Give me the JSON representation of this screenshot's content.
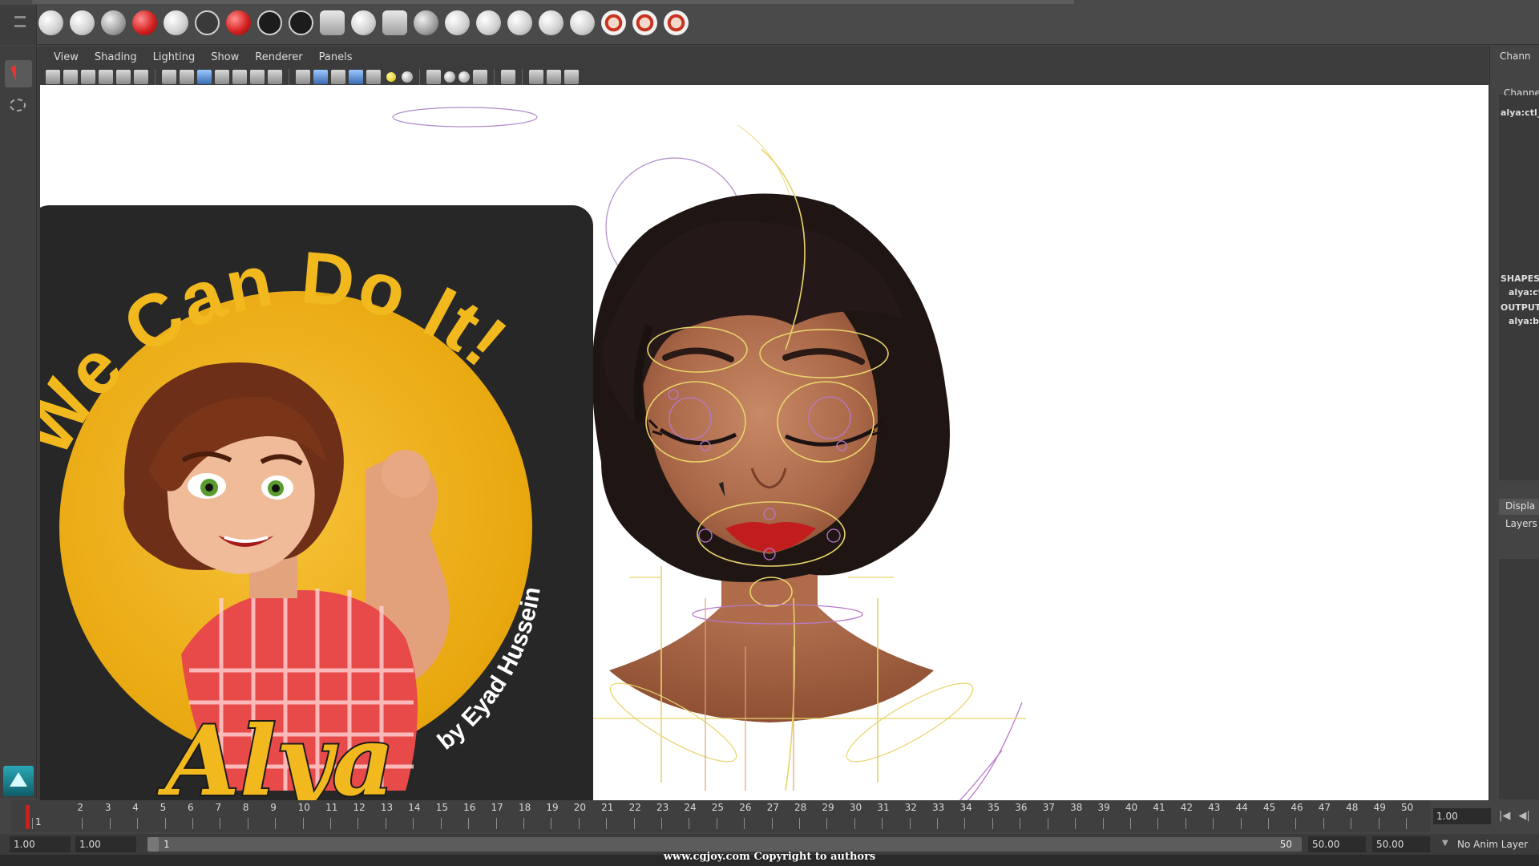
{
  "app": {
    "name": "Maya"
  },
  "panel_menu": [
    "View",
    "Shading",
    "Lighting",
    "Show",
    "Renderer",
    "Panels"
  ],
  "channel_box": {
    "title": "Chann",
    "header": "Channe",
    "object": "alya:ctl_",
    "shapes_label": "SHAPES",
    "shapes_item": "alya:ct",
    "outputs_label": "OUTPUT",
    "outputs_item": "alya:bl",
    "tab_display": "Displa",
    "tab_layers": "Layers"
  },
  "poster": {
    "title": "We Can Do It!",
    "name": "Alya",
    "byline": "by Eyad Hussein"
  },
  "timeline": {
    "ticks": [
      "1",
      "2",
      "3",
      "4",
      "5",
      "6",
      "7",
      "8",
      "9",
      "10",
      "11",
      "12",
      "13",
      "14",
      "15",
      "16",
      "17",
      "18",
      "19",
      "20",
      "21",
      "22",
      "23",
      "24",
      "25",
      "26",
      "27",
      "28",
      "29",
      "30",
      "31",
      "32",
      "33",
      "34",
      "35",
      "36",
      "37",
      "38",
      "39",
      "40",
      "41",
      "42",
      "43",
      "44",
      "45",
      "46",
      "47",
      "48",
      "49",
      "50"
    ],
    "current_frame_label": "1",
    "current_time": "1.00",
    "controls": [
      "|◀",
      "◀|"
    ]
  },
  "range": {
    "anim_start": "1.00",
    "playback_start": "1.00",
    "range_start": "1",
    "range_end": "50",
    "playback_end": "50.00",
    "anim_end": "50.00",
    "anim_layer": "No Anim Layer"
  },
  "footer": {
    "copyright": "www.cgjoy.com Copyright to authors"
  },
  "colors": {
    "viewport_bg": "#ffffff",
    "ui_bg": "#444444",
    "poster_yellow": "#f2b91f",
    "poster_dark": "#272727",
    "skin": "#b87453",
    "hair": "#1e1614",
    "lips": "#c21d1d",
    "rig_yellow": "#e8d46b",
    "rig_purple": "#a06ab0"
  },
  "icons": {
    "select_tool": "select-arrow-icon",
    "lasso_tool": "lasso-icon",
    "maya_logo": "maya-logo-icon"
  }
}
